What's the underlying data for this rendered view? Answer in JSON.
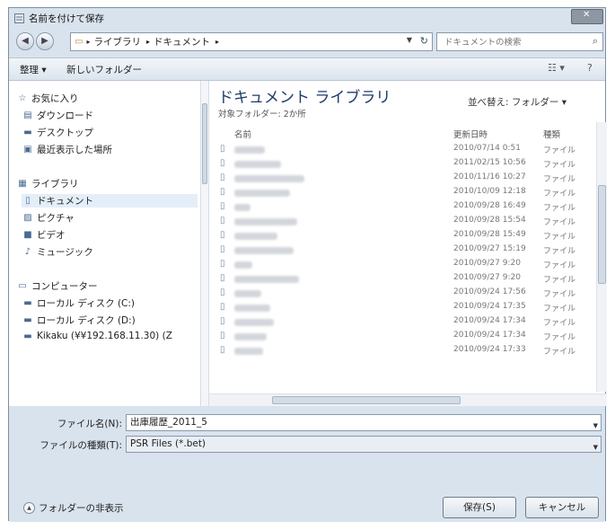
{
  "window": {
    "title": "名前を付けて保存"
  },
  "address": {
    "crumbs": [
      "ライブラリ",
      "ドキュメント"
    ],
    "search_placeholder": "ドキュメントの検索"
  },
  "toolbar": {
    "organize": "整理 ▾",
    "new_folder": "新しいフォルダー"
  },
  "nav": {
    "favorites": "お気に入り",
    "downloads": "ダウンロード",
    "desktop": "デスクトップ",
    "recent": "最近表示した場所",
    "libraries": "ライブラリ",
    "documents": "ドキュメント",
    "pictures": "ピクチャ",
    "videos": "ビデオ",
    "music": "ミュージック",
    "computer": "コンピューター",
    "local_c": "ローカル ディスク (C:)",
    "local_d": "ローカル ディスク (D:)",
    "network": "Kikaku (¥¥192.168.11.30) (Z"
  },
  "files": {
    "library_title": "ドキュメント ライブラリ",
    "library_sub": "対象フォルダー: 2か所",
    "arrange": "並べ替え: フォルダー ▾",
    "col_name": "名前",
    "col_date": "更新日時",
    "col_type": "種類",
    "rows": [
      {
        "date": "2010/07/14 0:51",
        "type": "ファイル"
      },
      {
        "date": "2011/02/15 10:56",
        "type": "ファイル"
      },
      {
        "date": "2010/11/16 10:27",
        "type": "ファイル"
      },
      {
        "date": "2010/10/09 12:18",
        "type": "ファイル"
      },
      {
        "date": "2010/09/28 16:49",
        "type": "ファイル"
      },
      {
        "date": "2010/09/28 15:54",
        "type": "ファイル"
      },
      {
        "date": "2010/09/28 15:49",
        "type": "ファイル"
      },
      {
        "date": "2010/09/27 15:19",
        "type": "ファイル"
      },
      {
        "date": "2010/09/27 9:20",
        "type": "ファイル"
      },
      {
        "date": "2010/09/27 9:20",
        "type": "ファイル"
      },
      {
        "date": "2010/09/24 17:56",
        "type": "ファイル"
      },
      {
        "date": "2010/09/24 17:35",
        "type": "ファイル"
      },
      {
        "date": "2010/09/24 17:34",
        "type": "ファイル"
      },
      {
        "date": "2010/09/24 17:34",
        "type": "ファイル"
      },
      {
        "date": "2010/09/24 17:33",
        "type": "ファイル"
      }
    ]
  },
  "form": {
    "filename_label": "ファイル名(N):",
    "filename_value": "出庫履歴_2011_5",
    "filetype_label": "ファイルの種類(T):",
    "filetype_value": "PSR Files (*.bet)",
    "hide_folders": "フォルダーの非表示",
    "save": "保存(S)",
    "cancel": "キャンセル"
  }
}
